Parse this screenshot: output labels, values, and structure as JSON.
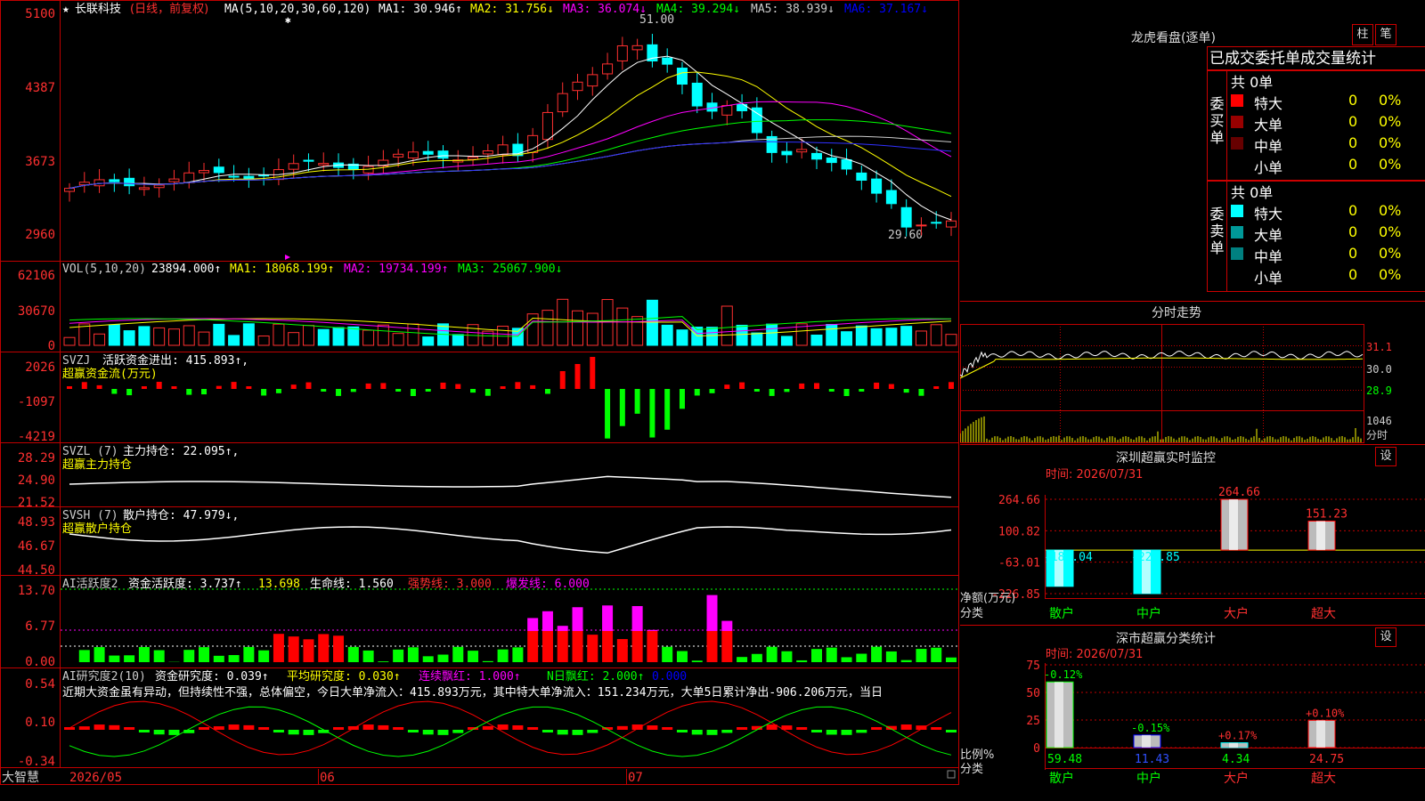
{
  "header": {
    "star": "★",
    "stock_name": "长联科技",
    "adjust": "(日线，前复权)",
    "ma_label": "MA(5,10,20,30,60,120)",
    "ma": [
      {
        "text": "MA1: 30.946↑",
        "color": "#ffffff"
      },
      {
        "text": "MA2: 31.756↓",
        "color": "#ffff00"
      },
      {
        "text": "MA3: 36.074↓",
        "color": "#ff00ff"
      },
      {
        "text": "MA4: 39.294↓",
        "color": "#00ff00"
      },
      {
        "text": "MA5: 38.939↓",
        "color": "#cccccc"
      },
      {
        "text": "MA6: 37.167↓",
        "color": "#0000ff"
      }
    ],
    "high_label": "51.00",
    "low_label": "29.60"
  },
  "price_axis": [
    "5100",
    "4387",
    "3673",
    "2960"
  ],
  "vol": {
    "label": "VOL(5,10,20)",
    "value": "23894.000↑",
    "ma1": "MA1: 18068.199↑",
    "ma2": "MA2: 19734.199↑",
    "ma3": "MA3: 25067.900↓",
    "axis": [
      "62106",
      "30670",
      "0"
    ]
  },
  "svzj": {
    "title": "SVZJ",
    "label": "活跃资金进出: 415.893↑,",
    "sub": "超赢资金流(万元)",
    "axis": [
      "2026",
      "-1097",
      "-4219"
    ]
  },
  "svzl": {
    "title": "SVZL (7)",
    "label": "主力持仓: 22.095↑,",
    "sub": "超赢主力持仓",
    "axis": [
      "28.29",
      "24.90",
      "21.52"
    ]
  },
  "svsh": {
    "title": "SVSH (7)",
    "label": "散户持仓: 47.979↓,",
    "sub": "超赢散户持仓",
    "axis": [
      "48.93",
      "46.67",
      "44.50"
    ]
  },
  "ai_active": {
    "title": "AI活跃度2",
    "label": "资金活跃度: 3.737↑",
    "v2": "13.698",
    "v3": "生命线: 1.560",
    "v4": "强势线: 3.000",
    "v5": "爆发线: 6.000",
    "axis": [
      "13.70",
      "6.77",
      "0.00"
    ]
  },
  "ai_research": {
    "title": "AI研究度2(10)",
    "label": "资金研究度: 0.039↑",
    "avg": "平均研究度: 0.030↑",
    "red": "连续飘红: 1.000↑",
    "nday": "N日飘红: 2.000↑",
    "last": "0.000",
    "text": "近期大资金虽有异动，但持续性不强，总体偏空，今日大单净流入：415.893万元，其中特大单净流入：151.234万元，大单5日累计净出-906.206万元，当日",
    "axis": [
      "0.54",
      "0.10",
      "-0.34"
    ]
  },
  "date_axis": {
    "brand": "大智慧",
    "d1": "2026/05",
    "d2": "06",
    "d3": "07"
  },
  "dragon": {
    "title": "龙虎看盘(逐单)",
    "btn1": "柱",
    "btn2": "笔",
    "tabs": "已成交委托单成交量统计",
    "buy_label": "委买单",
    "sell_label": "委卖单",
    "buy_total": "共 0单",
    "sell_total": "共 0单",
    "buy_rows": [
      {
        "name": "特大",
        "count": "0",
        "pct": "0%",
        "color": "#ff0000"
      },
      {
        "name": "大单",
        "count": "0",
        "pct": "0%",
        "color": "#990000"
      },
      {
        "name": "中单",
        "count": "0",
        "pct": "0%",
        "color": "#660000"
      },
      {
        "name": "小单",
        "count": "0",
        "pct": "0%",
        "color": ""
      }
    ],
    "sell_rows": [
      {
        "name": "特大",
        "count": "0",
        "pct": "0%",
        "color": "#00ffff"
      },
      {
        "name": "大单",
        "count": "0",
        "pct": "0%",
        "color": "#009999"
      },
      {
        "name": "中单",
        "count": "0",
        "pct": "0%",
        "color": "#008080"
      },
      {
        "name": "小单",
        "count": "0",
        "pct": "0%",
        "color": ""
      }
    ]
  },
  "intraday": {
    "title": "分时走势",
    "axis": [
      "31.1",
      "30.0",
      "28.9"
    ],
    "vol": "1046",
    "vol_label": "分时"
  },
  "sz_monitor": {
    "title": "深圳超赢实时监控",
    "btn": "设",
    "time": "时间: 2026/07/31",
    "axis": [
      "264.66",
      "100.82",
      "-63.01",
      "-226.85"
    ],
    "net_label": "净额(万元)",
    "cat_label": "分类",
    "bars": [
      {
        "name": "散户",
        "value": -189.04,
        "label": "-189.04"
      },
      {
        "name": "中户",
        "value": -226.85,
        "label": "-226.85"
      },
      {
        "name": "大户",
        "value": 264.66,
        "label": "264.66"
      },
      {
        "name": "超大",
        "value": 151.23,
        "label": "151.23"
      }
    ]
  },
  "sz_stat": {
    "title": "深市超赢分类统计",
    "btn": "设",
    "time": "时间: 2026/07/31",
    "axis": [
      "75",
      "50",
      "25",
      "0"
    ],
    "ratio_label": "比例%",
    "cat_label": "分类",
    "bars": [
      {
        "name": "散户",
        "value": 59.48,
        "label": "59.48",
        "change": "-0.12%"
      },
      {
        "name": "中户",
        "value": 11.43,
        "label": "11.43",
        "change": "-0.15%"
      },
      {
        "name": "大户",
        "value": 4.34,
        "label": "4.34",
        "change": "+0.17%"
      },
      {
        "name": "超大",
        "value": 24.75,
        "label": "24.75",
        "change": "+0.10%"
      }
    ]
  }
}
